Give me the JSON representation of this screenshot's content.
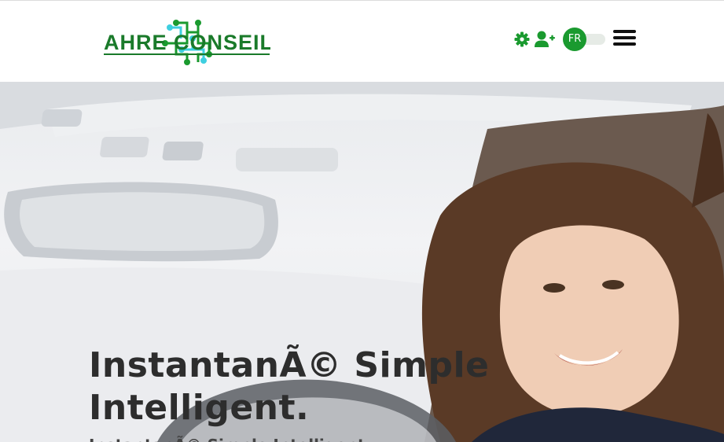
{
  "header": {
    "logo_text": "AHRE CONSEIL",
    "settings_icon": "gear-icon",
    "add_user_icon": "user-plus-icon",
    "language": "FR",
    "menu_icon": "hamburger-icon",
    "brand_color": "#1a9a2f",
    "logo_accent_color": "#3ecfe0"
  },
  "hero": {
    "title_line1": "InstantanÃ© Simple",
    "title_line2": "Intelligent.",
    "subtitle": "InstantanÃ© Simple Intelligent.",
    "image": "woman-driving-car-photo"
  }
}
